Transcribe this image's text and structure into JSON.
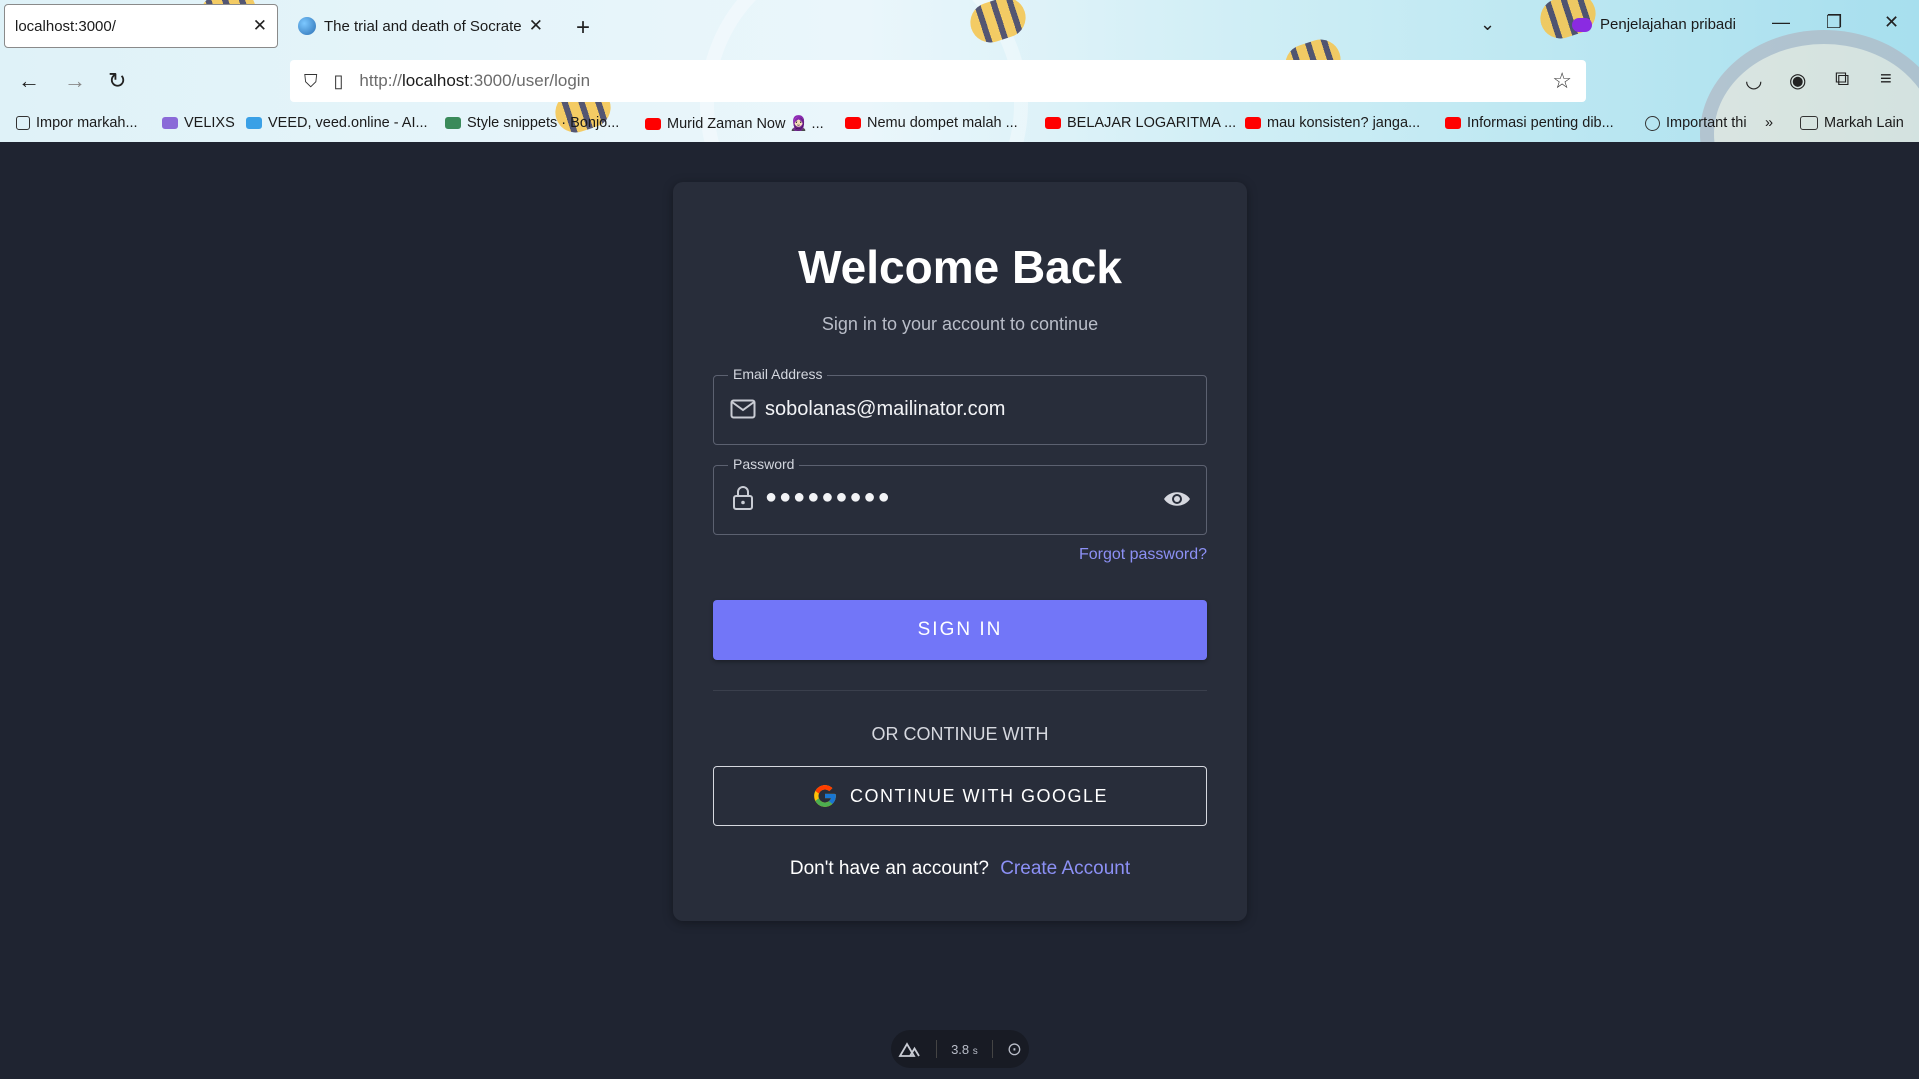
{
  "browser": {
    "tabs": [
      {
        "title": "localhost:3000/",
        "active": true
      },
      {
        "title": "The trial and death of Socrates",
        "active": false
      }
    ],
    "new_tab_label": "+",
    "private_label": "Penjelajahan pribadi",
    "url_scheme": "http://",
    "url_host": "localhost",
    "url_path": ":3000/user/login",
    "bookmarks": [
      {
        "label": "Impor markah...",
        "icon": "import-icon"
      },
      {
        "label": "VELIXS",
        "icon": "velixs-icon"
      },
      {
        "label": "VEED, veed.online - AI...",
        "icon": "veed-icon"
      },
      {
        "label": "Style snippets · Bonjo...",
        "icon": "style-icon"
      },
      {
        "label": "Murid Zaman Now 🧕🏻 ...",
        "icon": "youtube-icon"
      },
      {
        "label": "Nemu dompet malah ...",
        "icon": "youtube-icon"
      },
      {
        "label": "BELAJAR LOGARITMA ...",
        "icon": "youtube-icon"
      },
      {
        "label": "mau konsisten? janga...",
        "icon": "youtube-icon"
      },
      {
        "label": "Informasi penting dib...",
        "icon": "youtube-icon"
      },
      {
        "label": "Important thi",
        "icon": "globe-icon"
      }
    ],
    "overflow_label": "»",
    "other_bookmarks_label": "Markah Lain"
  },
  "login": {
    "title": "Welcome Back",
    "subtitle": "Sign in to your account to continue",
    "email_label": "Email Address",
    "email_value": "sobolanas@mailinator.com",
    "password_label": "Password",
    "password_value": "●●●●●●●●●",
    "forgot_label": "Forgot password?",
    "signin_label": "SIGN IN",
    "or_label": "OR CONTINUE WITH",
    "google_label": "CONTINUE WITH GOOGLE",
    "no_account_label": "Don't have an account?",
    "create_account_label": "Create Account"
  },
  "devtools": {
    "time_label": "3.8",
    "time_unit": "s"
  }
}
